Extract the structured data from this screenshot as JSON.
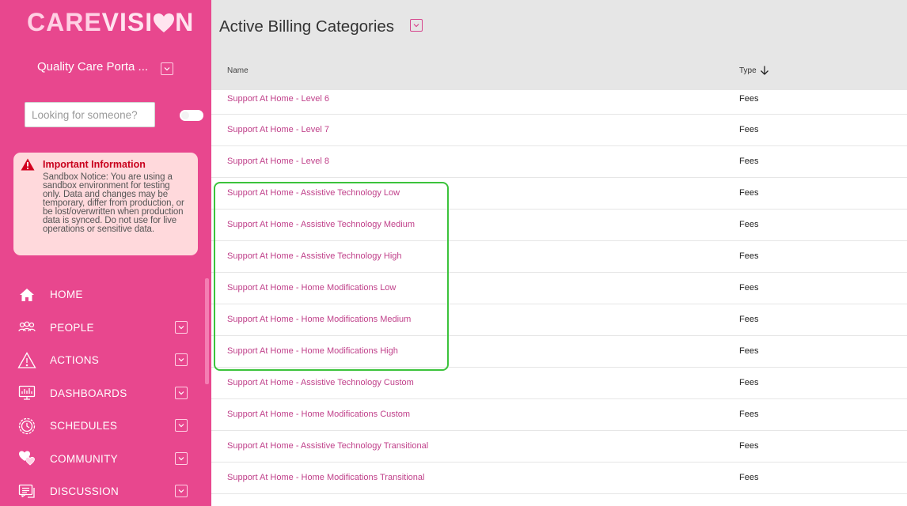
{
  "brand": {
    "part1": "CARE",
    "part2": "VISI",
    "part3": "N"
  },
  "org": {
    "name": "Quality Care Porta ..."
  },
  "search": {
    "placeholder": "Looking for someone?"
  },
  "info": {
    "title": "Important Information",
    "text": "Sandbox Notice: You are using a sandbox environment for testing only. Data and changes may be temporary, differ from production, or be lost/overwritten when production data is synced. Do not use for live operations or sensitive data."
  },
  "nav": [
    {
      "label": "HOME",
      "icon": "home-icon",
      "has_chevron": false
    },
    {
      "label": "PEOPLE",
      "icon": "people-icon",
      "has_chevron": true
    },
    {
      "label": "ACTIONS",
      "icon": "warning-icon",
      "has_chevron": true
    },
    {
      "label": "DASHBOARDS",
      "icon": "dashboard-icon",
      "has_chevron": true
    },
    {
      "label": "SCHEDULES",
      "icon": "clock-icon",
      "has_chevron": true
    },
    {
      "label": "COMMUNITY",
      "icon": "community-icon",
      "has_chevron": true
    },
    {
      "label": "DISCUSSION",
      "icon": "discussion-icon",
      "has_chevron": true
    }
  ],
  "main": {
    "title": "Active Billing Categories",
    "columns": {
      "name": "Name",
      "type": "Type"
    },
    "rows": [
      {
        "name": "Support At Home - Level 6",
        "type": "Fees"
      },
      {
        "name": "Support At Home - Level 7",
        "type": "Fees"
      },
      {
        "name": "Support At Home - Level 8",
        "type": "Fees"
      },
      {
        "name": "Support At Home - Assistive Technology Low",
        "type": "Fees"
      },
      {
        "name": "Support At Home - Assistive Technology Medium",
        "type": "Fees"
      },
      {
        "name": "Support At Home - Assistive Technology High",
        "type": "Fees"
      },
      {
        "name": "Support At Home - Home Modifications Low",
        "type": "Fees"
      },
      {
        "name": "Support At Home - Home Modifications Medium",
        "type": "Fees"
      },
      {
        "name": "Support At Home - Home Modifications High",
        "type": "Fees"
      },
      {
        "name": "Support At Home - Assistive Technology Custom",
        "type": "Fees"
      },
      {
        "name": "Support At Home - Home Modifications Custom",
        "type": "Fees"
      },
      {
        "name": "Support At Home - Assistive Technology Transitional",
        "type": "Fees"
      },
      {
        "name": "Support At Home - Home Modifications Transitional",
        "type": "Fees"
      }
    ]
  },
  "colors": {
    "sidebar": "#e8478e",
    "accent": "#c0408a",
    "highlight": "#3cc33c"
  }
}
